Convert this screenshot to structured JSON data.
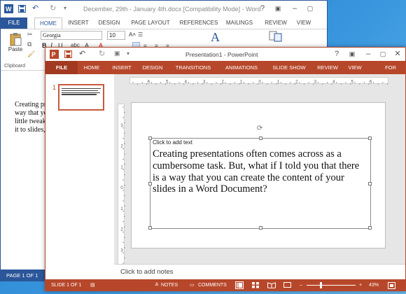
{
  "word": {
    "title": "December, 29th - January 4th.docx [Compatibility Mode] - Word",
    "tabs": [
      "FILE",
      "HOME",
      "INSERT",
      "DESIGN",
      "PAGE LAYOUT",
      "REFERENCES",
      "MAILINGS",
      "REVIEW",
      "VIEW"
    ],
    "font_name": "Georgia",
    "font_size": "10",
    "paste_label": "Paste",
    "clipboard_label": "Clipboard",
    "doc_lines": [
      "Creating pre",
      "way that yo",
      "little tweak",
      "it to slides, p"
    ],
    "status": "PAGE 1 OF 1"
  },
  "ppt": {
    "title": "Presentation1 - PowerPoint",
    "tabs": [
      "FILE",
      "HOME",
      "INSERT",
      "DESIGN",
      "TRANSITIONS",
      "ANIMATIONS",
      "SLIDE SHOW",
      "REVIEW",
      "VIEW",
      "FOR"
    ],
    "slide_number": "1",
    "placeholder_label": "Click to add text",
    "slide_text": "Creating presentations often comes across as a cumbersome task. But, what if I told you that there is a way that you can create the content of your slides in a Word Document?",
    "notes_placeholder": "Click to add notes",
    "status": {
      "slide": "SLIDE 1 OF 1",
      "notes": "NOTES",
      "comments": "COMMENTS",
      "zoom": "43%"
    },
    "ruler_h": [
      "6",
      "5",
      "4",
      "3",
      "2",
      "1",
      "0",
      "1",
      "2",
      "3",
      "4",
      "5",
      "6"
    ],
    "ruler_v": [
      "3",
      "2",
      "1",
      "0",
      "1",
      "2",
      "3"
    ]
  },
  "colors": {
    "word_accent": "#2b579a",
    "ppt_accent": "#b7472a",
    "desktop": "#2f8ad6"
  }
}
